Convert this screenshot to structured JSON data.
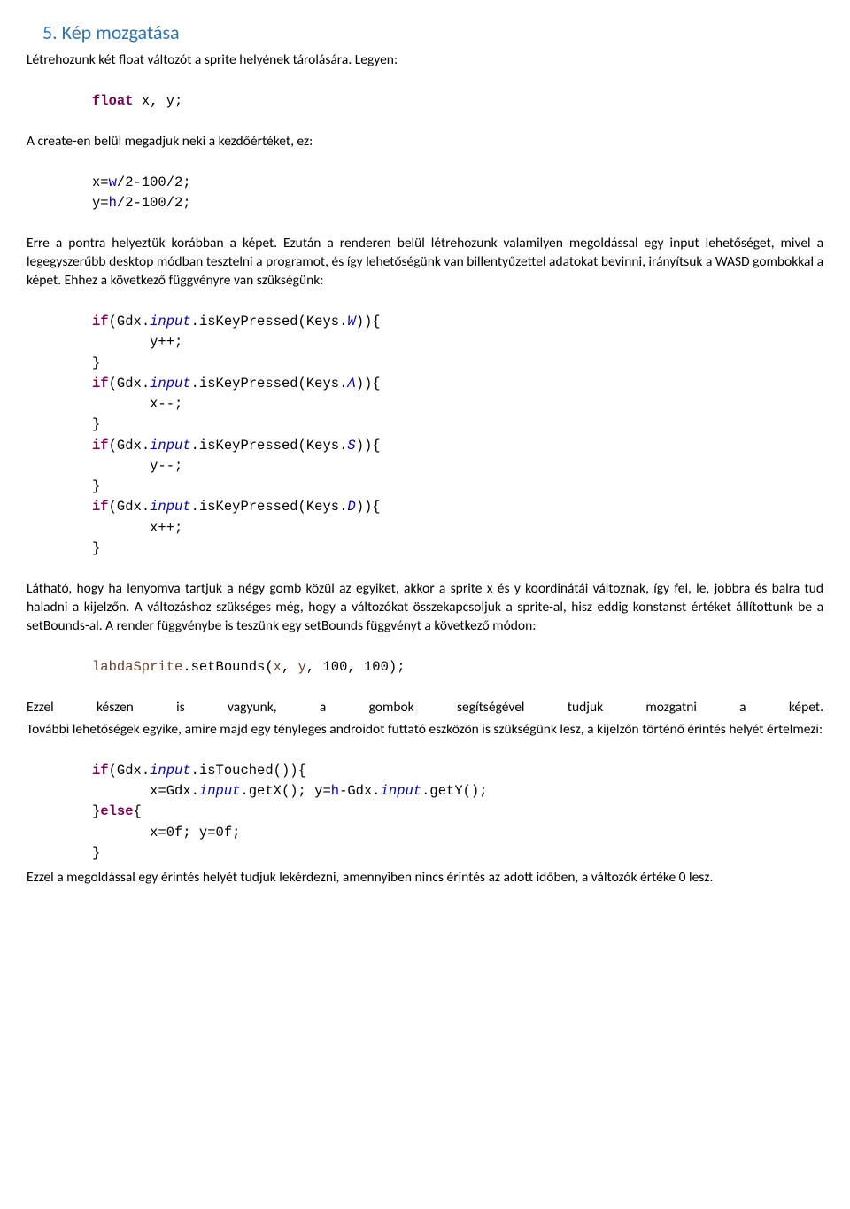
{
  "section": {
    "title": "5. Kép mozgatása"
  },
  "p1": "Létrehozunk két float változót a sprite helyének tárolására. Legyen:",
  "code1": {
    "kw": "float",
    "rest": " x, y;"
  },
  "p2": "A create-en belül megadjuk neki a kezdőértéket, ez:",
  "code2": {
    "l1a": "x=",
    "l1b": "w",
    "l1c": "/2-100/2;",
    "l2a": "y=",
    "l2b": "h",
    "l2c": "/2-100/2;"
  },
  "p3": "Erre a pontra helyeztük korábban a képet. Ezután a renderen belül létrehozunk valamilyen megoldással egy input lehetőséget, mivel a legegyszerűbb desktop módban tesztelni a programot, és így lehetőségünk van billentyűzettel adatokat bevinni, irányítsuk a WASD gombokkal a képet. Ehhez a következő függvényre van szükségünk:",
  "code3": {
    "if": "if",
    "gdx": "(Gdx.",
    "input": "input",
    "isKey": ".isKeyPressed(Keys.",
    "w": "W",
    "a": "A",
    "s": "S",
    "d": "D",
    "close": ")){",
    "yinc": "       y++;",
    "xdec": "       x--;",
    "ydec": "       y--;",
    "xinc": "       x++;",
    "brace": "}"
  },
  "p4": "Látható, hogy ha lenyomva tartjuk a négy gomb közül az egyiket, akkor a sprite x és y koordinátái változnak, így fel, le, jobbra és balra tud haladni a kijelzőn. A változáshoz szükséges még, hogy a változókat összekapcsoljuk a sprite-al, hisz eddig konstanst értéket állítottunk be a setBounds-al. A render függvénybe is teszünk egy setBounds függvényt a következő módon:",
  "code4": {
    "l1a": "labdaSprite",
    "l1b": ".setBounds(",
    "l1c": "x",
    "l1d": ", ",
    "l1e": "y",
    "l1f": ", 100, 100);"
  },
  "p5a": "Ezzel készen is vagyunk, a gombok segítségével tudjuk mozgatni a képet.",
  "p5b": "További lehetőségek egyike, amire majd egy tényleges androidot futtató eszközön is szükségünk lesz, a kijelzőn történő érintés helyét értelmezi:",
  "code5": {
    "if": "if",
    "gdx": "(Gdx.",
    "input": "input",
    "istouch": ".isTouched()){",
    "l2a": "       x=Gdx.",
    "l2b": "input",
    "l2c": ".getX(); y=",
    "l2d": "h",
    "l2e": "-Gdx.",
    "l2f": "input",
    "l2g": ".getY();",
    "else1": "}",
    "else": "else",
    "else2": "{",
    "l4": "       x=0f; y=0f;",
    "brace": "}"
  },
  "p6": "Ezzel a megoldással egy érintés helyét tudjuk lekérdezni, amennyiben nincs érintés az adott időben, a változók értéke 0 lesz."
}
